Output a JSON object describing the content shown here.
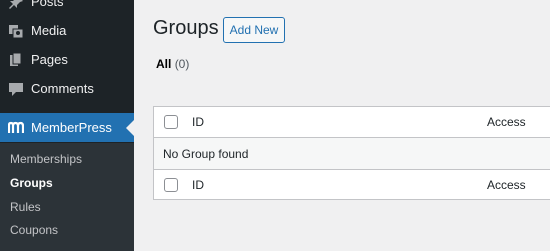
{
  "sidebar": {
    "items": [
      {
        "label": "Posts",
        "icon": "pushpin-icon"
      },
      {
        "label": "Media",
        "icon": "media-icon"
      },
      {
        "label": "Pages",
        "icon": "pages-icon"
      },
      {
        "label": "Comments",
        "icon": "comments-icon"
      },
      {
        "label": "MemberPress",
        "icon": "memberpress-icon",
        "active": true
      }
    ],
    "submenu": [
      {
        "label": "Memberships"
      },
      {
        "label": "Groups",
        "current": true
      },
      {
        "label": "Rules"
      },
      {
        "label": "Coupons"
      }
    ]
  },
  "main": {
    "title": "Groups",
    "add_new_label": "Add New",
    "views": {
      "all_label": "All",
      "all_count": "(0)"
    },
    "table": {
      "columns": [
        "ID",
        "Access"
      ],
      "empty_message": "No Group found"
    }
  },
  "colors": {
    "sidebar_bg": "#1d2327",
    "submenu_bg": "#2c3338",
    "accent": "#2271b1",
    "page_bg": "#f0f0f1"
  }
}
